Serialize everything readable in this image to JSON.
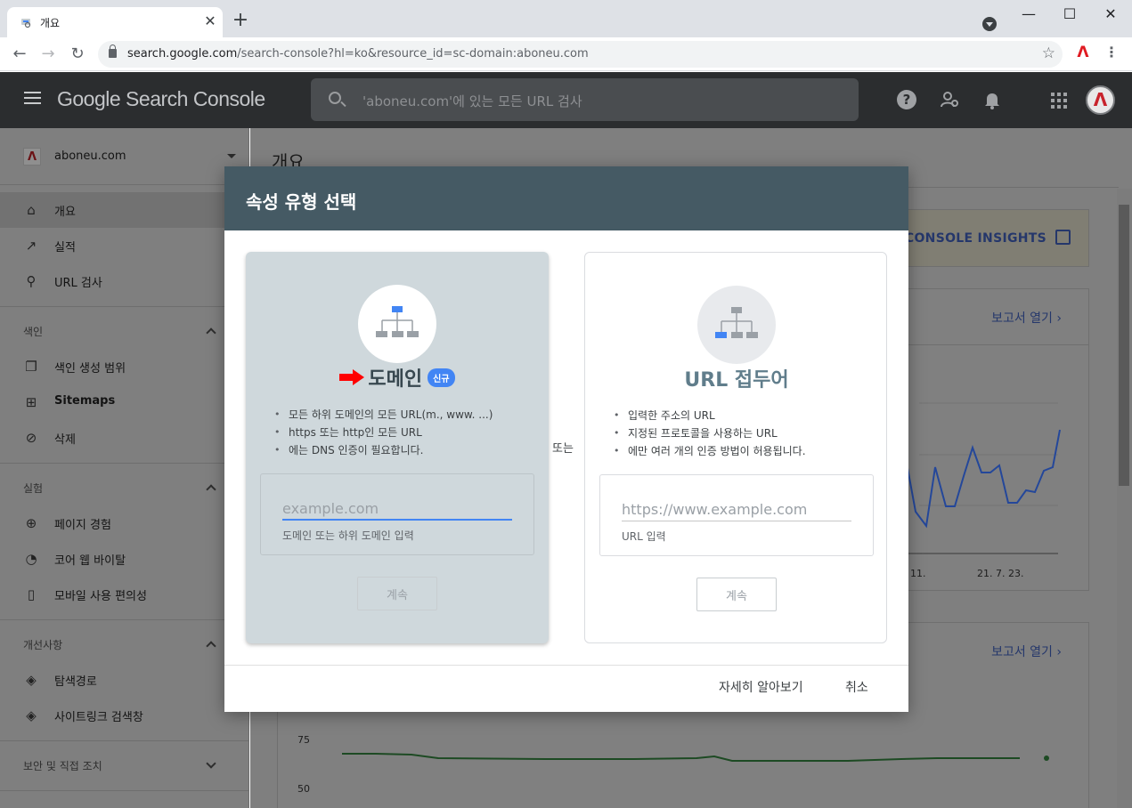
{
  "browser": {
    "tab_title": "개요",
    "url_host": "search.google.com",
    "url_path": "/search-console?hl=ko&resource_id=sc-domain:aboneu.com",
    "controls": {
      "minimize": "—",
      "maximize": "☐",
      "close": "✕",
      "new_tab": "+",
      "tab_close": "✕"
    }
  },
  "header": {
    "logo": "Google Search Console",
    "search_placeholder": "'aboneu.com'에 있는 모든 URL 검사"
  },
  "sidebar": {
    "property": "aboneu.com",
    "top_items": [
      {
        "label": "개요",
        "icon": "home-icon"
      },
      {
        "label": "실적",
        "icon": "trending-icon"
      },
      {
        "label": "URL 검사",
        "icon": "search-icon"
      }
    ],
    "index_section": "색인",
    "index_items": [
      {
        "label": "색인 생성 범위",
        "icon": "copy-icon"
      },
      {
        "label": "Sitemaps",
        "icon": "sitemap-icon"
      },
      {
        "label": "삭제",
        "icon": "eye-off-icon"
      }
    ],
    "experience_section": "실험",
    "experience_items": [
      {
        "label": "페이지 경험",
        "icon": "plus-circle-icon"
      },
      {
        "label": "코어 웹 바이탈",
        "icon": "gauge-icon"
      },
      {
        "label": "모바일 사용 편의성",
        "icon": "phone-icon"
      }
    ],
    "enhancements_section": "개선사항",
    "enhancement_items": [
      {
        "label": "탐색경로",
        "icon": "layers-icon"
      },
      {
        "label": "사이트링크 검색창",
        "icon": "layers-icon"
      }
    ],
    "security_section": "보안 및 직접 조치"
  },
  "main": {
    "title": "개요",
    "insights_label": "CONSOLE INSIGHTS",
    "report_link": "보고서 열기",
    "report_link_2": "보고서 열기",
    "chart_ticks_x": [
      "11.",
      "21. 7. 23."
    ],
    "chart2_ticks_y": [
      "75",
      "50"
    ]
  },
  "modal": {
    "title": "속성 유형 선택",
    "or_label": "또는",
    "domain": {
      "title": "도메인",
      "badge": "신규",
      "bullets": [
        "모든 하위 도메인의 모든 URL(m., www. ...)",
        "https 또는 http인 모든 URL",
        "에는 DNS 인증이 필요합니다."
      ],
      "placeholder": "example.com",
      "helper": "도메인 또는 하위 도메인 입력",
      "continue": "계속"
    },
    "prefix": {
      "title": "URL 접두어",
      "bullets": [
        "입력한 주소의 URL",
        "지정된 프로토콜을 사용하는 URL",
        "에만 여러 개의 인증 방법이 허용됩니다."
      ],
      "placeholder": "https://www.example.com",
      "helper": "URL 입력",
      "continue": "계속"
    },
    "learn_more": "자세히 알아보기",
    "cancel": "취소"
  },
  "colors": {
    "modal_header": "#455a64",
    "domain_card": "#cfd8dc",
    "accent_blue": "#4285f4",
    "arrow_red": "#ff0000"
  }
}
